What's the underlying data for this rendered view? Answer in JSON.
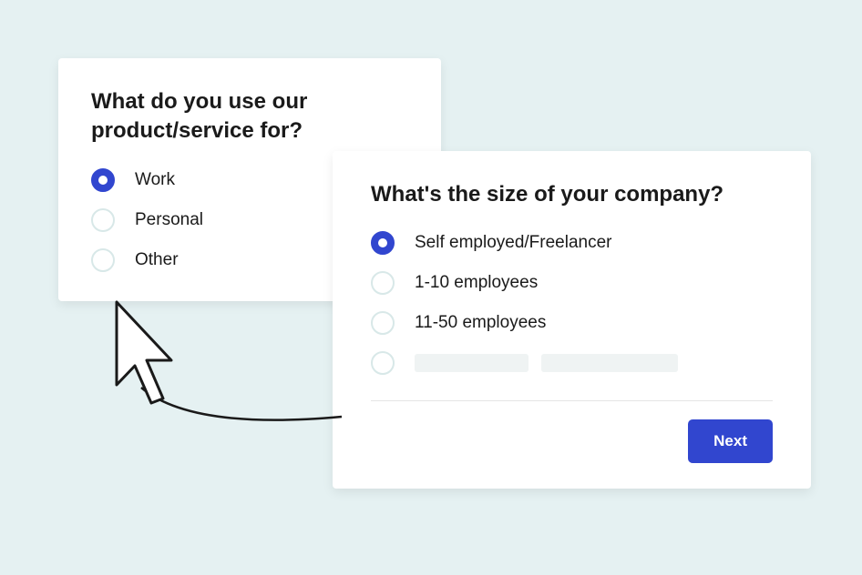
{
  "card1": {
    "question": "What do you use our product/service for?",
    "options": [
      {
        "label": "Work",
        "selected": true
      },
      {
        "label": "Personal",
        "selected": false
      },
      {
        "label": "Other",
        "selected": false
      }
    ]
  },
  "card2": {
    "question": "What's the size of your company?",
    "options": [
      {
        "label": "Self employed/Freelancer",
        "selected": true
      },
      {
        "label": "1-10 employees",
        "selected": false
      },
      {
        "label": "11-50 employees",
        "selected": false
      }
    ],
    "next_label": "Next"
  }
}
